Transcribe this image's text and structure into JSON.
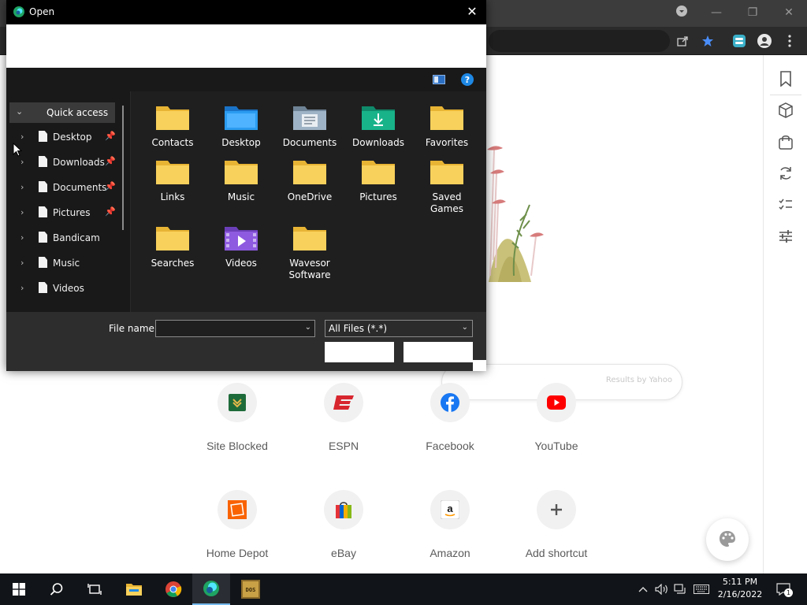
{
  "browser": {
    "window_controls": {
      "minimize": "—",
      "restore": "❐",
      "close": "✕"
    },
    "search_hint": "Results by Yahoo",
    "shortcuts": [
      {
        "label": "Site Blocked",
        "icon": "site-blocked-icon"
      },
      {
        "label": "ESPN",
        "icon": "espn-icon"
      },
      {
        "label": "Facebook",
        "icon": "facebook-icon"
      },
      {
        "label": "YouTube",
        "icon": "youtube-icon"
      },
      {
        "label": "Home Depot",
        "icon": "home-depot-icon"
      },
      {
        "label": "eBay",
        "icon": "ebay-icon"
      },
      {
        "label": "Amazon",
        "icon": "amazon-icon"
      },
      {
        "label": "Add shortcut",
        "icon": "plus-icon"
      }
    ],
    "side_panel_icons": [
      "bookmark-icon",
      "box-icon",
      "shopping-bag-icon",
      "refresh-icon",
      "checklist-icon",
      "sliders-icon"
    ]
  },
  "dialog": {
    "title": "Open",
    "close_glyph": "✕",
    "nav": {
      "quick_access": "Quick access",
      "items": [
        {
          "label": "Desktop",
          "pinned": true
        },
        {
          "label": "Downloads",
          "pinned": true
        },
        {
          "label": "Documents",
          "pinned": true
        },
        {
          "label": "Pictures",
          "pinned": true
        },
        {
          "label": "Bandicam",
          "pinned": false
        },
        {
          "label": "Music",
          "pinned": false
        },
        {
          "label": "Videos",
          "pinned": false
        }
      ]
    },
    "folders": [
      {
        "label": "Contacts",
        "icon": "folder-icon"
      },
      {
        "label": "Desktop",
        "icon": "desktop-folder-icon"
      },
      {
        "label": "Documents",
        "icon": "documents-folder-icon"
      },
      {
        "label": "Downloads",
        "icon": "downloads-folder-icon"
      },
      {
        "label": "Favorites",
        "icon": "folder-icon"
      },
      {
        "label": "Links",
        "icon": "folder-icon"
      },
      {
        "label": "Music",
        "icon": "folder-icon"
      },
      {
        "label": "OneDrive",
        "icon": "folder-icon"
      },
      {
        "label": "Pictures",
        "icon": "folder-icon"
      },
      {
        "label": "Saved Games",
        "icon": "folder-icon"
      },
      {
        "label": "Searches",
        "icon": "folder-icon"
      },
      {
        "label": "Videos",
        "icon": "videos-folder-icon"
      },
      {
        "label": "Wavesor Software",
        "icon": "folder-icon"
      }
    ],
    "file_name_label": "File name:",
    "file_name_value": "",
    "file_type": "All Files (*.*)"
  },
  "taskbar": {
    "time": "5:11 PM",
    "date": "2/16/2022",
    "notification_count": "1",
    "apps": [
      "start-icon",
      "search-icon",
      "task-view-icon",
      "file-explorer-icon",
      "chrome-icon",
      "edge-icon",
      "dosbox-icon"
    ]
  },
  "colors": {
    "dialog_bg": "#1f1f1f",
    "folder_yellow": "#f6c744",
    "accent": "#0078d4",
    "taskbar": "#111418"
  }
}
